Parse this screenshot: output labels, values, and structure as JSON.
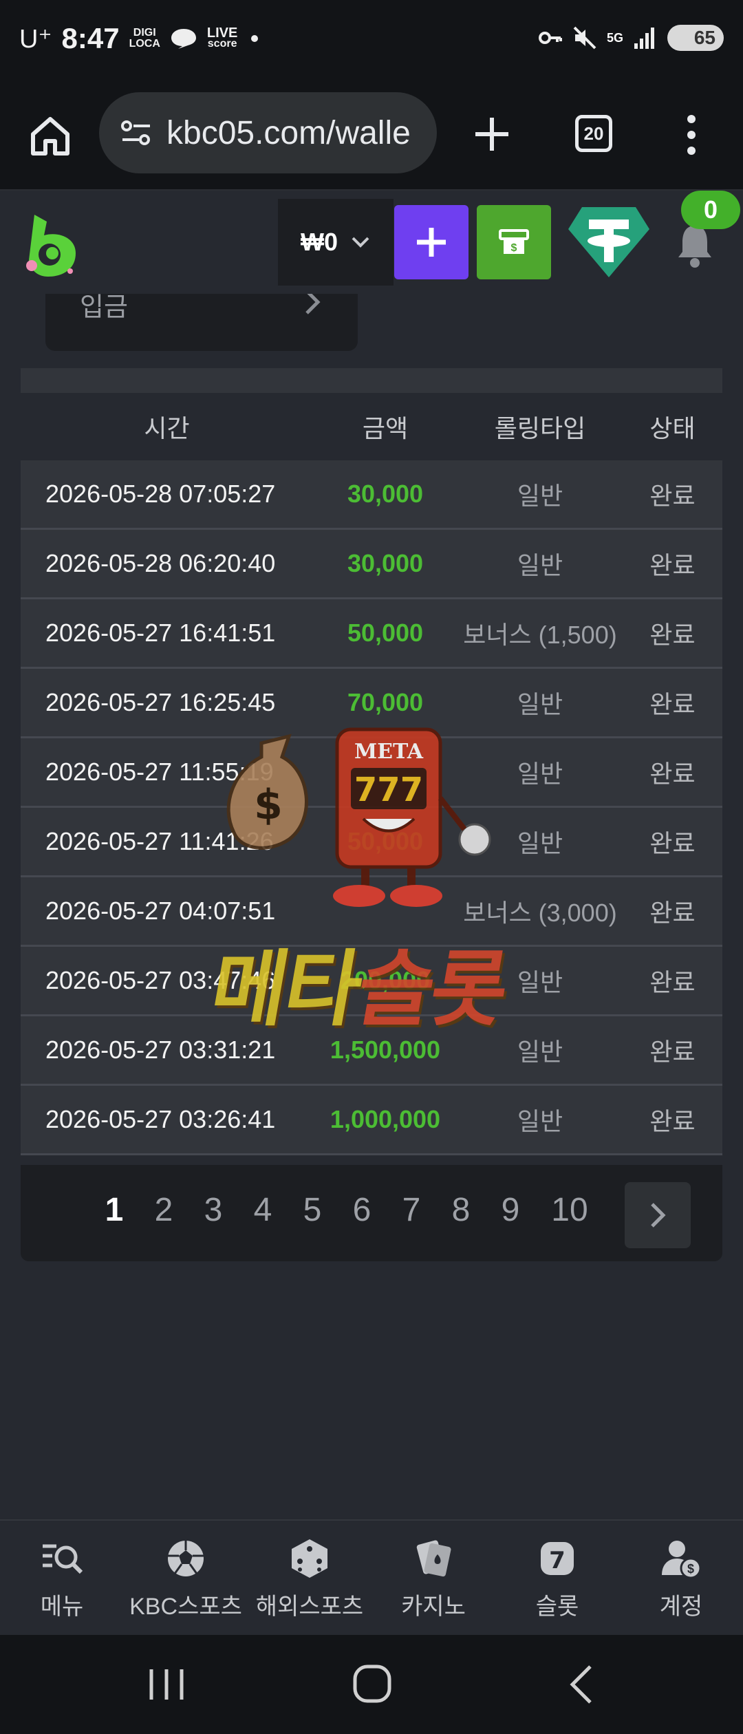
{
  "status_bar": {
    "carrier": "U⁺",
    "time": "8:47",
    "app1_line1": "DIGI",
    "app1_line2": "LOCA",
    "app2_line1": "LIVE",
    "app2_line2": "score",
    "network": "5G",
    "battery": "65"
  },
  "browser": {
    "url": "kbc05.com/walle",
    "tab_count": "20"
  },
  "header": {
    "balance": "₩0",
    "notification_count": "0"
  },
  "deposit": {
    "label": "입금"
  },
  "table": {
    "columns": [
      "시간",
      "금액",
      "롤링타입",
      "상태"
    ],
    "rows": [
      {
        "time": "2026-05-28 07:05:27",
        "amount": "30,000",
        "type": "일반",
        "status": "완료"
      },
      {
        "time": "2026-05-28 06:20:40",
        "amount": "30,000",
        "type": "일반",
        "status": "완료"
      },
      {
        "time": "2026-05-27 16:41:51",
        "amount": "50,000",
        "type": "보너스 (1,500)",
        "status": "완료"
      },
      {
        "time": "2026-05-27 16:25:45",
        "amount": "70,000",
        "type": "일반",
        "status": "완료"
      },
      {
        "time": "2026-05-27 11:55:19",
        "amount": "",
        "type": "일반",
        "status": "완료"
      },
      {
        "time": "2026-05-27 11:41:26",
        "amount": "50,000",
        "type": "일반",
        "status": "완료"
      },
      {
        "time": "2026-05-27 04:07:51",
        "amount": "",
        "type": "보너스 (3,000)",
        "status": "완료"
      },
      {
        "time": "2026-05-27 03:47:46",
        "amount": "200,000",
        "type": "일반",
        "status": "완료"
      },
      {
        "time": "2026-05-27 03:31:21",
        "amount": "1,500,000",
        "type": "일반",
        "status": "완료"
      },
      {
        "time": "2026-05-27 03:26:41",
        "amount": "1,000,000",
        "type": "일반",
        "status": "완료"
      }
    ]
  },
  "pagination": {
    "pages": [
      "1",
      "2",
      "3",
      "4",
      "5",
      "6",
      "7",
      "8",
      "9",
      "10"
    ],
    "current": "1"
  },
  "watermark": {
    "sign": "META",
    "reels": "777",
    "text_part1": "메타",
    "text_part2": "슬롯"
  },
  "bottom_nav": [
    {
      "label": "메뉴",
      "icon": "menu-search-icon"
    },
    {
      "label": "KBC스포츠",
      "icon": "soccer-ball-icon"
    },
    {
      "label": "해외스포츠",
      "icon": "dice-icon"
    },
    {
      "label": "카지노",
      "icon": "cards-icon"
    },
    {
      "label": "슬롯",
      "icon": "slot-seven-icon"
    },
    {
      "label": "계정",
      "icon": "account-icon"
    }
  ],
  "colors": {
    "background": "#262930",
    "row_bg": "#32353b",
    "amount_green": "#4cbd34",
    "plus_button": "#6f3ff0",
    "cashier_button": "#4ea72e",
    "tether_green": "#26a17b"
  }
}
